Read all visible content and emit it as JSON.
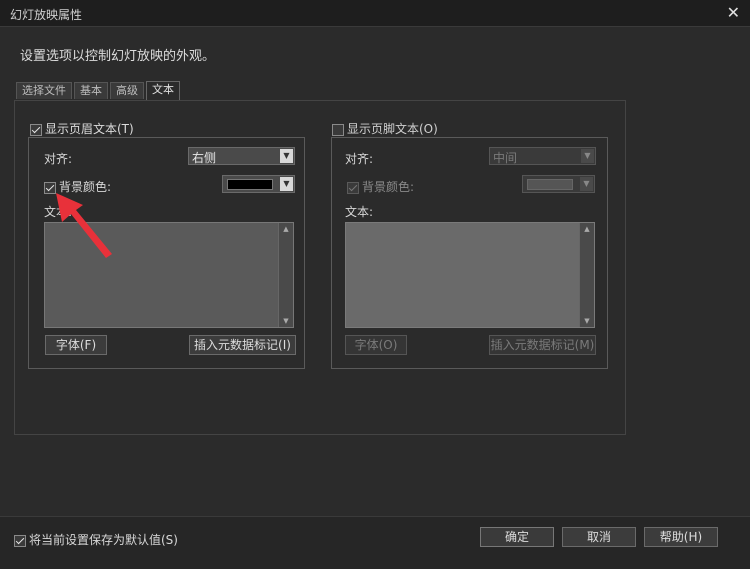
{
  "window": {
    "title": "幻灯放映属性",
    "close_glyph": "✕"
  },
  "description": "设置选项以控制幻灯放映的外观。",
  "tabs": [
    {
      "label": "选择文件"
    },
    {
      "label": "基本"
    },
    {
      "label": "高级"
    },
    {
      "label": "文本",
      "active": true
    }
  ],
  "header_section": {
    "enabled_label": "显示页眉文本(T)",
    "enabled": true,
    "align_label": "对齐:",
    "align_value": "右侧",
    "bgcolor_label": "背景颜色:",
    "bgcolor_checked": true,
    "bgcolor_value": "#000000",
    "text_label": "文本:",
    "text_value": "",
    "font_button": "字体(F)",
    "metadata_button": "插入元数据标记(I)"
  },
  "footer_section": {
    "enabled_label": "显示页脚文本(O)",
    "enabled": false,
    "align_label": "对齐:",
    "align_value": "中间",
    "bgcolor_label": "背景颜色:",
    "bgcolor_checked": true,
    "bgcolor_value": "#555555",
    "text_label": "文本:",
    "text_value": "",
    "font_button": "字体(O)",
    "metadata_button": "插入元数据标记(M)"
  },
  "footer": {
    "save_default_label": "将当前设置保存为默认值(S)",
    "save_default_checked": true,
    "ok_button": "确定",
    "cancel_button": "取消",
    "help_button": "帮助(H)"
  },
  "colors": {
    "annotation_arrow": "#e8313a",
    "dialog_bg": "#2b2b2b"
  }
}
